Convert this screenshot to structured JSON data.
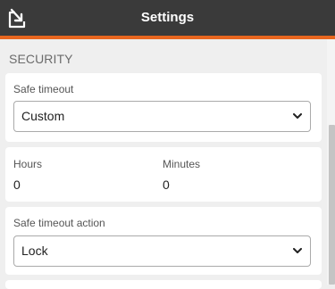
{
  "header": {
    "title": "Settings",
    "back_icon": "exit-arrow-icon",
    "accent_color": "#e8661f",
    "background_color": "#3a3a3a"
  },
  "section": {
    "title": "SECURITY"
  },
  "safe_timeout": {
    "label": "Safe timeout",
    "value": "Custom"
  },
  "custom_timeout": {
    "hours_label": "Hours",
    "hours_value": "0",
    "minutes_label": "Minutes",
    "minutes_value": "0"
  },
  "safe_timeout_action": {
    "label": "Safe timeout action",
    "value": "Lock"
  }
}
